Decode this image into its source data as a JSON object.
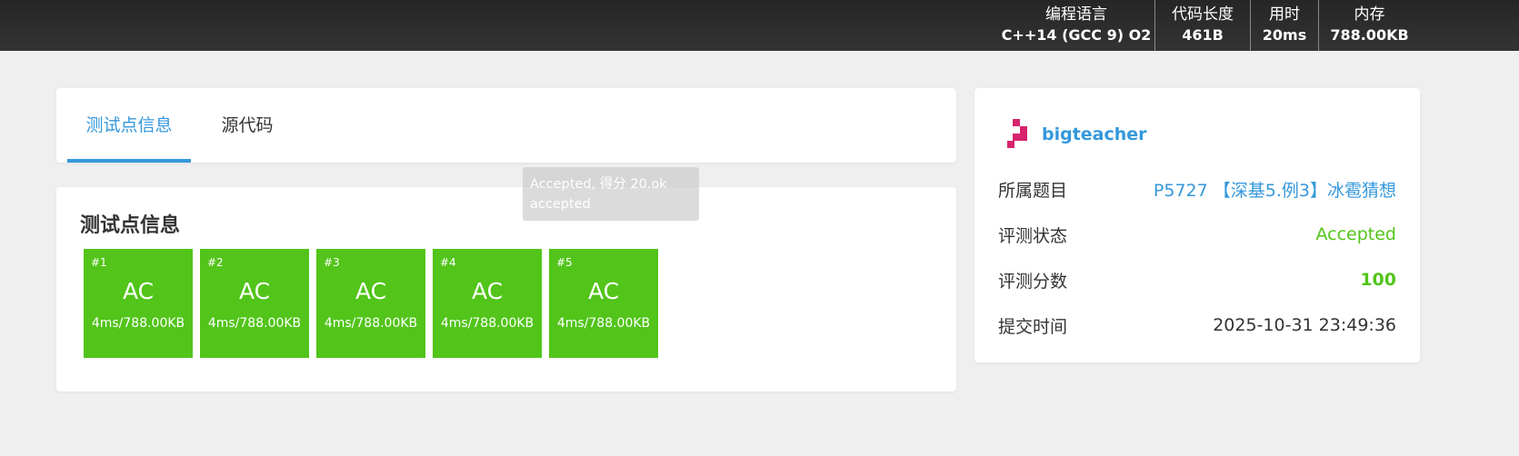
{
  "header": {
    "stats": [
      {
        "label": "编程语言",
        "value": "C++14 (GCC 9) O2"
      },
      {
        "label": "代码长度",
        "value": "461B"
      },
      {
        "label": "用时",
        "value": "20ms"
      },
      {
        "label": "内存",
        "value": "788.00KB"
      }
    ]
  },
  "tabs": [
    {
      "label": "测试点信息",
      "active": true
    },
    {
      "label": "源代码",
      "active": false
    }
  ],
  "tests": {
    "title": "测试点信息",
    "cases": [
      {
        "num": "#1",
        "result": "AC",
        "info": "4ms/788.00KB"
      },
      {
        "num": "#2",
        "result": "AC",
        "info": "4ms/788.00KB"
      },
      {
        "num": "#3",
        "result": "AC",
        "info": "4ms/788.00KB"
      },
      {
        "num": "#4",
        "result": "AC",
        "info": "4ms/788.00KB"
      },
      {
        "num": "#5",
        "result": "AC",
        "info": "4ms/788.00KB"
      }
    ]
  },
  "tooltip": {
    "line1": "Accepted, 得分 20.ok",
    "line2": "accepted"
  },
  "info": {
    "username": "bigteacher",
    "avatar_icon": "pixel-avatar-icon",
    "rows": [
      {
        "label": "所属题目",
        "value": "P5727 【深基5.例3】冰雹猜想"
      },
      {
        "label": "评测状态",
        "value": "Accepted"
      },
      {
        "label": "评测分数",
        "value": "100"
      },
      {
        "label": "提交时间",
        "value": "2025-10-31 23:49:36"
      }
    ]
  },
  "colors": {
    "accent": "#3498db",
    "accepted": "#52c41a",
    "avatar": "#d6246e"
  }
}
